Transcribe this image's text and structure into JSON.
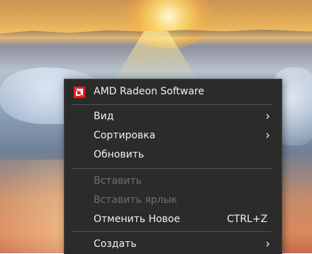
{
  "menu": {
    "top_item": {
      "label": "AMD Radeon Software"
    },
    "items": [
      {
        "label": "Вид",
        "submenu": true
      },
      {
        "label": "Сортировка",
        "submenu": true
      },
      {
        "label": "Обновить"
      },
      {
        "label": "Вставить",
        "disabled": true
      },
      {
        "label": "Вставить ярлык",
        "disabled": true
      },
      {
        "label": "Отменить Новое",
        "shortcut": "CTRL+Z"
      },
      {
        "label": "Создать",
        "submenu": true
      }
    ],
    "icons": {
      "amd": "amd-logo-icon",
      "submenu": "chevron-right-icon"
    },
    "colors": {
      "menu_background": "#2b2b2b",
      "text": "#f2f2f2",
      "disabled_text": "#6f6f6f",
      "amd_red": "#ed1c24"
    }
  }
}
